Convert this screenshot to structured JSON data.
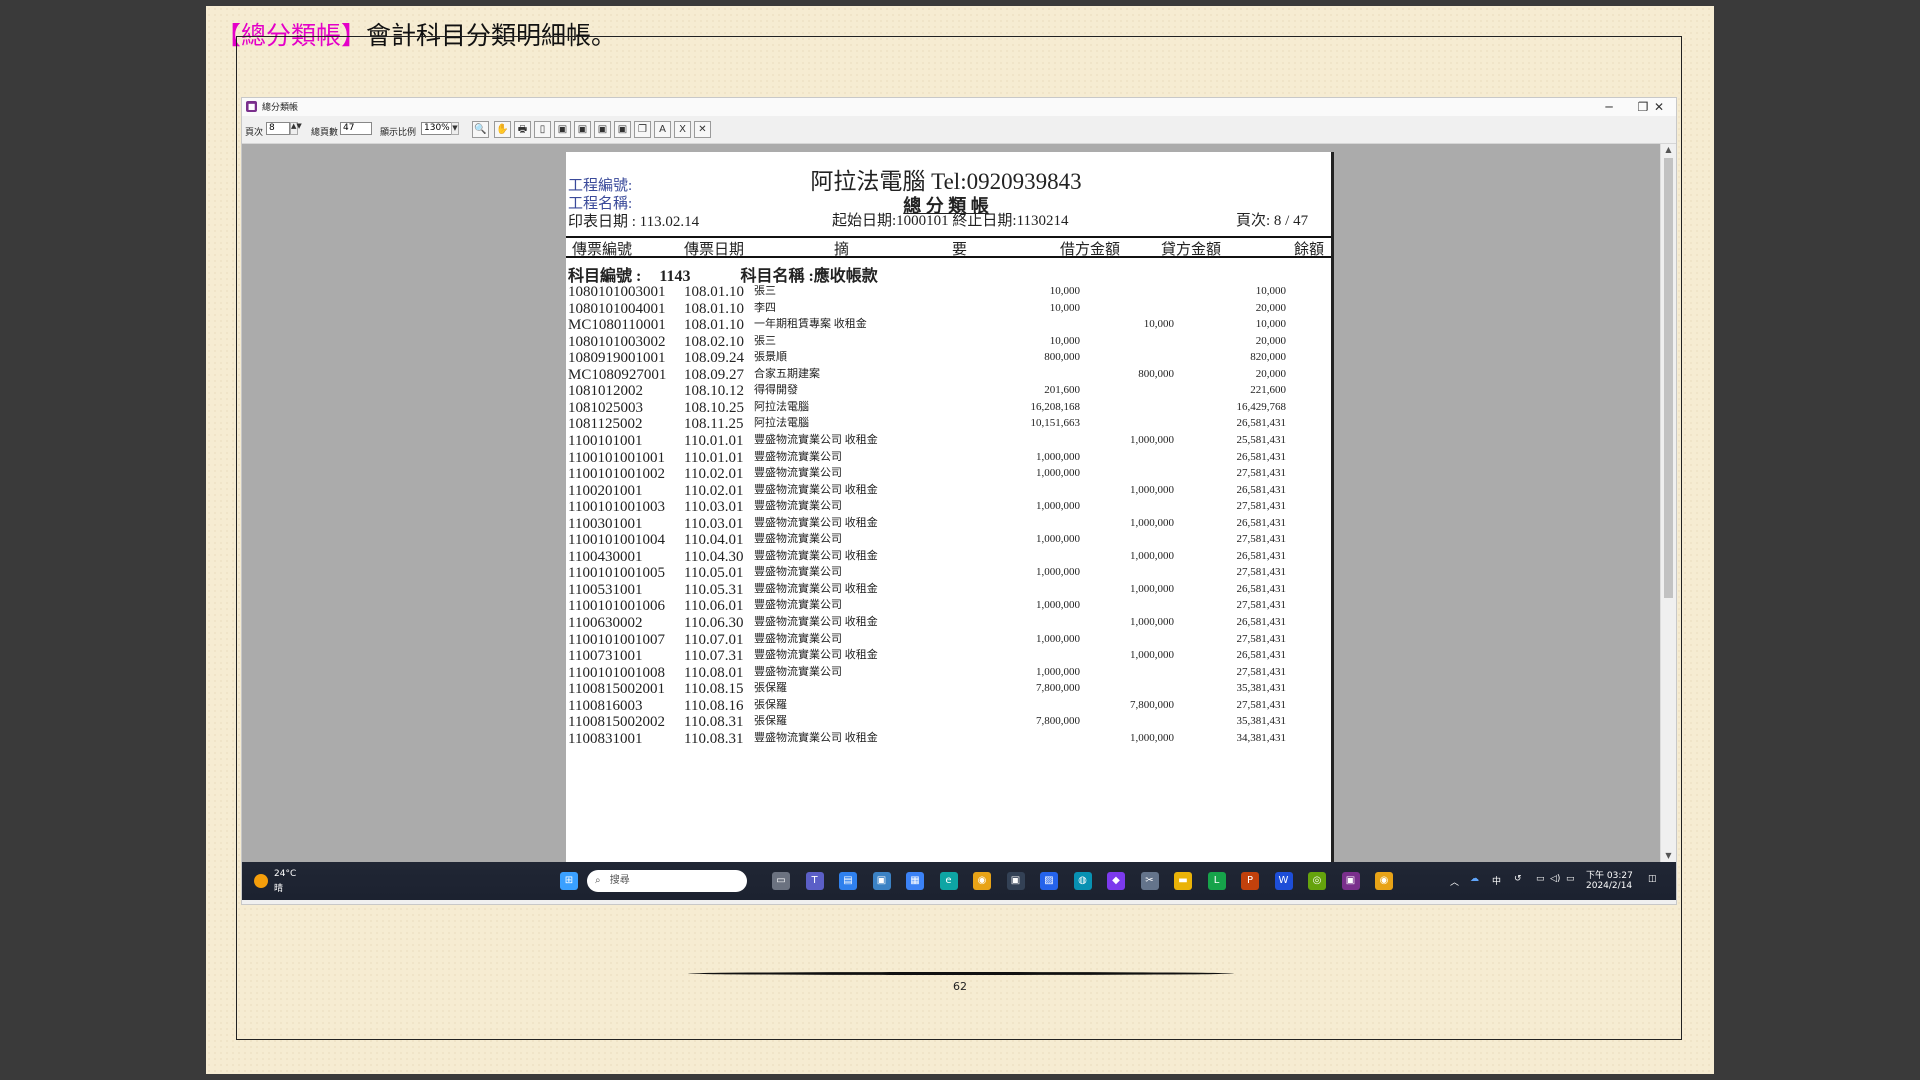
{
  "slide": {
    "title_hl": "【總分類帳】",
    "title_rest": "會計科目分類明細帳。",
    "page_number": "62"
  },
  "window": {
    "title": "總分類帳",
    "controls": [
      "─",
      "❐",
      "✕"
    ]
  },
  "toolbar": {
    "page_label": "頁次",
    "page_value": "8",
    "total_label": "總頁數",
    "total_value": "47",
    "zoom_label": "顯示比例",
    "zoom_value": "130%",
    "buttons": [
      {
        "name": "zoom-icon",
        "glyph": "🔍"
      },
      {
        "name": "hand-icon",
        "glyph": "✋"
      },
      {
        "name": "print-icon",
        "glyph": "🖶"
      },
      {
        "name": "page-icon",
        "glyph": "▯"
      },
      {
        "name": "export-icon",
        "glyph": "▣"
      },
      {
        "name": "export2-icon",
        "glyph": "▣"
      },
      {
        "name": "export3-icon",
        "glyph": "▣"
      },
      {
        "name": "export4-icon",
        "glyph": "▣"
      },
      {
        "name": "copy-icon",
        "glyph": "❐"
      },
      {
        "name": "pdf-icon",
        "glyph": "A"
      },
      {
        "name": "excel-icon",
        "glyph": "X"
      },
      {
        "name": "close-icon",
        "glyph": "✕"
      }
    ]
  },
  "report": {
    "company": "阿拉法電腦 Tel:0920939843",
    "book": "總 分 類 帳",
    "project_no_label": "工程編號:",
    "project_name_label": "工程名稱:",
    "print_date": "印表日期 : 113.02.14",
    "date_range": "起始日期:1000101 終止日期:1130214",
    "page_info": "頁次: 8 / 47",
    "columns": [
      "傳票編號",
      "傳票日期",
      "摘",
      "要",
      "借方金額",
      "貸方金額",
      "餘額"
    ],
    "account_label": "科目編號 :",
    "account_no": "1143",
    "account_name": "科目名稱 :應收帳款",
    "rows": [
      {
        "voucher": "1080101003001",
        "date": "108.01.10",
        "desc": "張三",
        "debit": "10,000",
        "credit": "",
        "balance": "10,000"
      },
      {
        "voucher": "1080101004001",
        "date": "108.01.10",
        "desc": "李四",
        "debit": "10,000",
        "credit": "",
        "balance": "20,000"
      },
      {
        "voucher": "MC1080110001",
        "date": "108.01.10",
        "desc": "一年期租賃專案 收租金",
        "debit": "",
        "credit": "10,000",
        "balance": "10,000"
      },
      {
        "voucher": "1080101003002",
        "date": "108.02.10",
        "desc": "張三",
        "debit": "10,000",
        "credit": "",
        "balance": "20,000"
      },
      {
        "voucher": "1080919001001",
        "date": "108.09.24",
        "desc": "張景順",
        "debit": "800,000",
        "credit": "",
        "balance": "820,000"
      },
      {
        "voucher": "MC1080927001",
        "date": "108.09.27",
        "desc": "合家五期建案",
        "debit": "",
        "credit": "800,000",
        "balance": "20,000"
      },
      {
        "voucher": "1081012002",
        "date": "108.10.12",
        "desc": "得得開發",
        "debit": "201,600",
        "credit": "",
        "balance": "221,600"
      },
      {
        "voucher": "1081025003",
        "date": "108.10.25",
        "desc": "阿拉法電腦",
        "debit": "16,208,168",
        "credit": "",
        "balance": "16,429,768"
      },
      {
        "voucher": "1081125002",
        "date": "108.11.25",
        "desc": "阿拉法電腦",
        "debit": "10,151,663",
        "credit": "",
        "balance": "26,581,431"
      },
      {
        "voucher": "1100101001",
        "date": "110.01.01",
        "desc": "豐盛物流實業公司 收租金",
        "debit": "",
        "credit": "1,000,000",
        "balance": "25,581,431"
      },
      {
        "voucher": "1100101001001",
        "date": "110.01.01",
        "desc": "豐盛物流實業公司",
        "debit": "1,000,000",
        "credit": "",
        "balance": "26,581,431"
      },
      {
        "voucher": "1100101001002",
        "date": "110.02.01",
        "desc": "豐盛物流實業公司",
        "debit": "1,000,000",
        "credit": "",
        "balance": "27,581,431"
      },
      {
        "voucher": "1100201001",
        "date": "110.02.01",
        "desc": "豐盛物流實業公司 收租金",
        "debit": "",
        "credit": "1,000,000",
        "balance": "26,581,431"
      },
      {
        "voucher": "1100101001003",
        "date": "110.03.01",
        "desc": "豐盛物流實業公司",
        "debit": "1,000,000",
        "credit": "",
        "balance": "27,581,431"
      },
      {
        "voucher": "1100301001",
        "date": "110.03.01",
        "desc": "豐盛物流實業公司 收租金",
        "debit": "",
        "credit": "1,000,000",
        "balance": "26,581,431"
      },
      {
        "voucher": "1100101001004",
        "date": "110.04.01",
        "desc": "豐盛物流實業公司",
        "debit": "1,000,000",
        "credit": "",
        "balance": "27,581,431"
      },
      {
        "voucher": "1100430001",
        "date": "110.04.30",
        "desc": "豐盛物流實業公司 收租金",
        "debit": "",
        "credit": "1,000,000",
        "balance": "26,581,431"
      },
      {
        "voucher": "1100101001005",
        "date": "110.05.01",
        "desc": "豐盛物流實業公司",
        "debit": "1,000,000",
        "credit": "",
        "balance": "27,581,431"
      },
      {
        "voucher": "1100531001",
        "date": "110.05.31",
        "desc": "豐盛物流實業公司 收租金",
        "debit": "",
        "credit": "1,000,000",
        "balance": "26,581,431"
      },
      {
        "voucher": "1100101001006",
        "date": "110.06.01",
        "desc": "豐盛物流實業公司",
        "debit": "1,000,000",
        "credit": "",
        "balance": "27,581,431"
      },
      {
        "voucher": "1100630002",
        "date": "110.06.30",
        "desc": "豐盛物流實業公司 收租金",
        "debit": "",
        "credit": "1,000,000",
        "balance": "26,581,431"
      },
      {
        "voucher": "1100101001007",
        "date": "110.07.01",
        "desc": "豐盛物流實業公司",
        "debit": "1,000,000",
        "credit": "",
        "balance": "27,581,431"
      },
      {
        "voucher": "1100731001",
        "date": "110.07.31",
        "desc": "豐盛物流實業公司 收租金",
        "debit": "",
        "credit": "1,000,000",
        "balance": "26,581,431"
      },
      {
        "voucher": "1100101001008",
        "date": "110.08.01",
        "desc": "豐盛物流實業公司",
        "debit": "1,000,000",
        "credit": "",
        "balance": "27,581,431"
      },
      {
        "voucher": "1100815002001",
        "date": "110.08.15",
        "desc": "張保羅",
        "debit": "7,800,000",
        "credit": "",
        "balance": "35,381,431"
      },
      {
        "voucher": "1100816003",
        "date": "110.08.16",
        "desc": "張保羅",
        "debit": "",
        "credit": "7,800,000",
        "balance": "27,581,431"
      },
      {
        "voucher": "1100815002002",
        "date": "110.08.31",
        "desc": "張保羅",
        "debit": "7,800,000",
        "credit": "",
        "balance": "35,381,431"
      },
      {
        "voucher": "1100831001",
        "date": "110.08.31",
        "desc": "豐盛物流實業公司 收租金",
        "debit": "",
        "credit": "1,000,000",
        "balance": "34,381,431"
      }
    ]
  },
  "taskbar": {
    "weather_temp": "24°C",
    "weather_desc": "晴",
    "search_placeholder": "搜尋",
    "time": "下午 03:27",
    "date": "2024/2/14",
    "ime": "中",
    "apps": [
      {
        "name": "windows-start-icon",
        "color": "#3aa0ff",
        "glyph": "⊞"
      },
      {
        "name": "task-view-icon",
        "color": "#6b7280",
        "glyph": "▭"
      },
      {
        "name": "teams-icon",
        "color": "#5b5fc7",
        "glyph": "T"
      },
      {
        "name": "notepad-icon",
        "color": "#2f80ed",
        "glyph": "▤"
      },
      {
        "name": "app-icon",
        "color": "#3b82c4",
        "glyph": "▣"
      },
      {
        "name": "store-icon",
        "color": "#3b82f6",
        "glyph": "▦"
      },
      {
        "name": "edge-icon",
        "color": "#0ea5a4",
        "glyph": "e"
      },
      {
        "name": "chrome-icon",
        "color": "#e8a317",
        "glyph": "◉"
      },
      {
        "name": "app2-icon",
        "color": "#334155",
        "glyph": "▣"
      },
      {
        "name": "photos-icon",
        "color": "#2563eb",
        "glyph": "▨"
      },
      {
        "name": "browser-icon",
        "color": "#0891b2",
        "glyph": "◍"
      },
      {
        "name": "visual-studio-icon",
        "color": "#7c3aed",
        "glyph": "◆"
      },
      {
        "name": "tools-icon",
        "color": "#64748b",
        "glyph": "✂"
      },
      {
        "name": "file-explorer-icon",
        "color": "#eab308",
        "glyph": "▬"
      },
      {
        "name": "line-icon",
        "color": "#16a34a",
        "glyph": "L"
      },
      {
        "name": "powerpoint-icon",
        "color": "#c2410c",
        "glyph": "P"
      },
      {
        "name": "word-icon",
        "color": "#1d4ed8",
        "glyph": "W"
      },
      {
        "name": "app3-icon",
        "color": "#65a30d",
        "glyph": "◎"
      },
      {
        "name": "ledger-app-icon",
        "color": "#7a2f8c",
        "glyph": "▣"
      },
      {
        "name": "chrome2-icon",
        "color": "#e8a317",
        "glyph": "◉"
      }
    ]
  }
}
